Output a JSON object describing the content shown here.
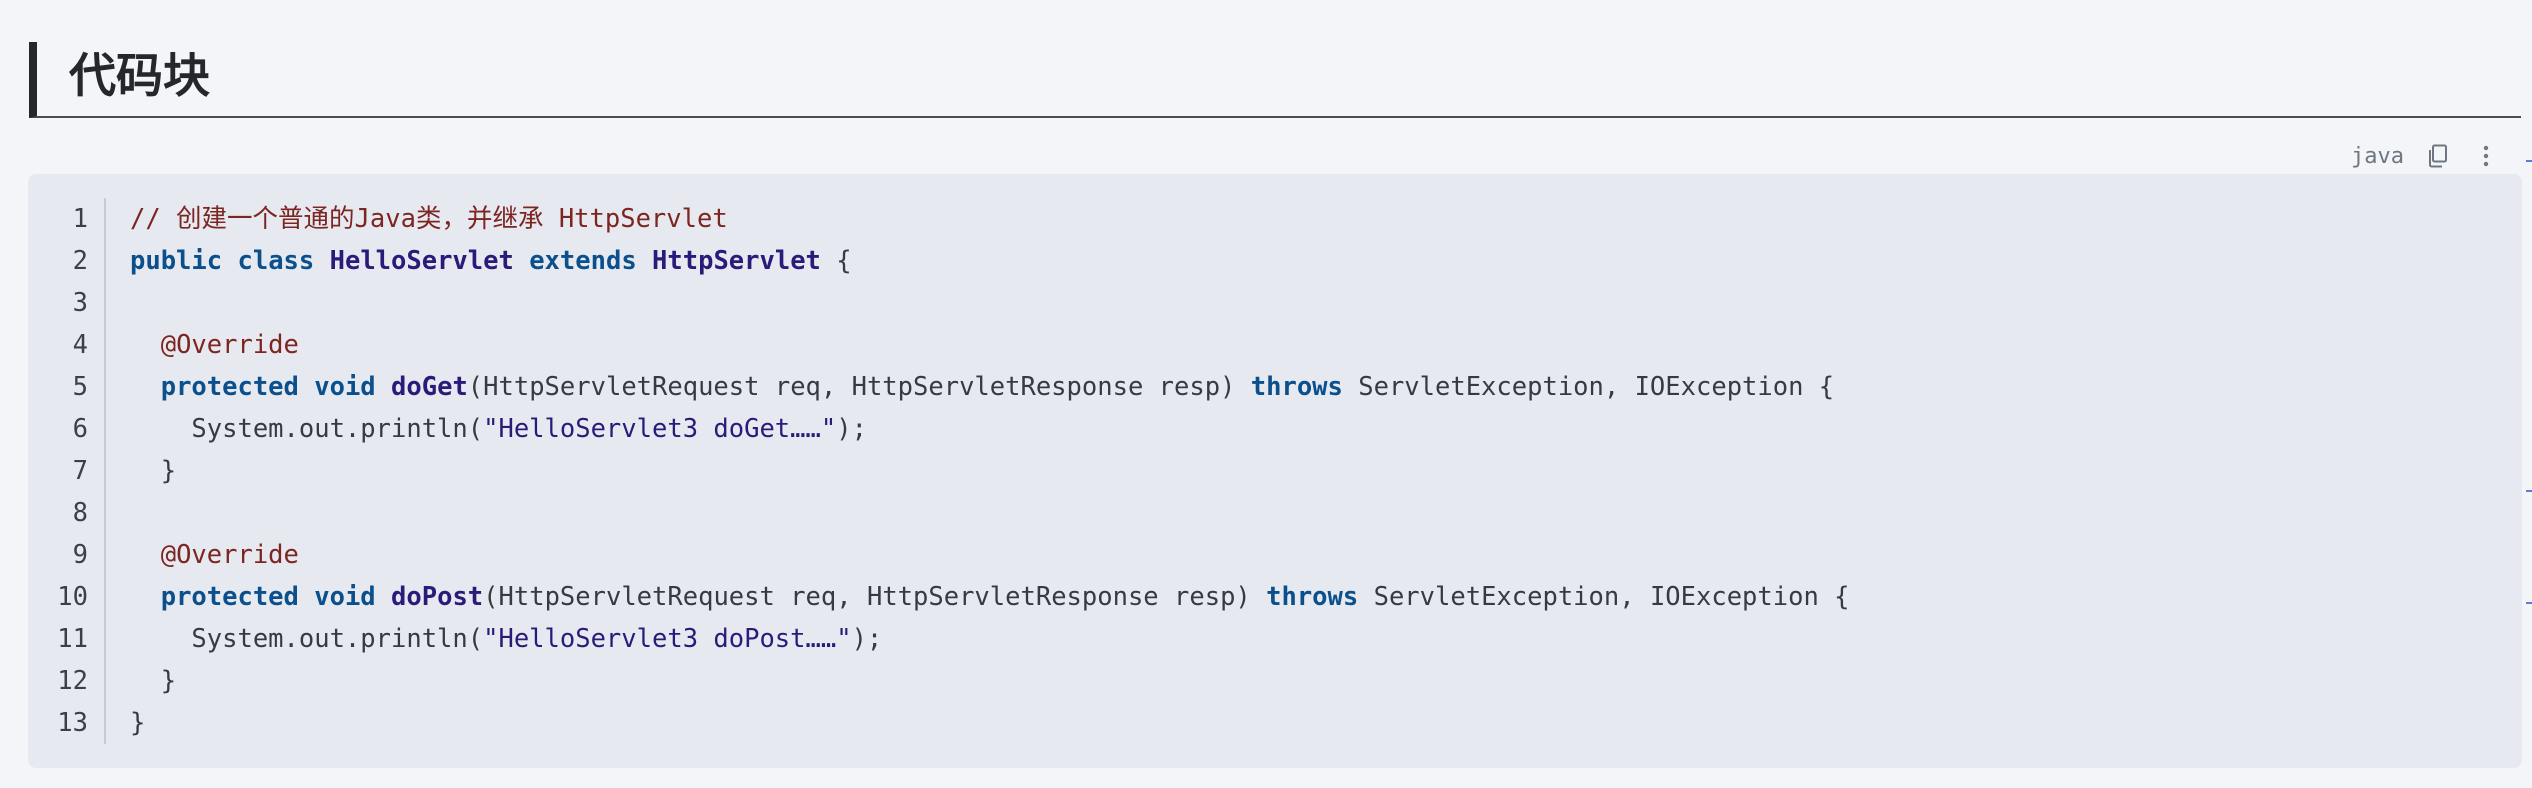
{
  "heading": {
    "title": "代码块"
  },
  "code_block": {
    "language": "java",
    "copy_icon": "copy-icon",
    "more_icon": "more-vertical-icon",
    "lines": [
      {
        "n": "1",
        "tokens": [
          {
            "t": "comment",
            "v": "// 创建一个普通的Java类，并继承 HttpServlet"
          }
        ]
      },
      {
        "n": "2",
        "tokens": [
          {
            "t": "kw",
            "v": "public"
          },
          {
            "t": "plain",
            "v": " "
          },
          {
            "t": "kw",
            "v": "class"
          },
          {
            "t": "plain",
            "v": " "
          },
          {
            "t": "cls",
            "v": "HelloServlet"
          },
          {
            "t": "plain",
            "v": " "
          },
          {
            "t": "kw",
            "v": "extends"
          },
          {
            "t": "plain",
            "v": " "
          },
          {
            "t": "cls",
            "v": "HttpServlet"
          },
          {
            "t": "plain",
            "v": " {"
          }
        ]
      },
      {
        "n": "3",
        "tokens": []
      },
      {
        "n": "4",
        "tokens": [
          {
            "t": "plain",
            "v": "  "
          },
          {
            "t": "ann",
            "v": "@Override"
          }
        ]
      },
      {
        "n": "5",
        "tokens": [
          {
            "t": "plain",
            "v": "  "
          },
          {
            "t": "kw",
            "v": "protected"
          },
          {
            "t": "plain",
            "v": " "
          },
          {
            "t": "kw",
            "v": "void"
          },
          {
            "t": "plain",
            "v": " "
          },
          {
            "t": "fn",
            "v": "doGet"
          },
          {
            "t": "plain",
            "v": "(HttpServletRequest req, HttpServletResponse resp) "
          },
          {
            "t": "kw",
            "v": "throws"
          },
          {
            "t": "plain",
            "v": " ServletException, IOException {"
          }
        ]
      },
      {
        "n": "6",
        "tokens": [
          {
            "t": "plain",
            "v": "    System.out.println("
          },
          {
            "t": "str",
            "v": "\"HelloServlet3 doGet……\""
          },
          {
            "t": "plain",
            "v": ");"
          }
        ]
      },
      {
        "n": "7",
        "tokens": [
          {
            "t": "plain",
            "v": "  }"
          }
        ]
      },
      {
        "n": "8",
        "tokens": []
      },
      {
        "n": "9",
        "tokens": [
          {
            "t": "plain",
            "v": "  "
          },
          {
            "t": "ann",
            "v": "@Override"
          }
        ]
      },
      {
        "n": "10",
        "tokens": [
          {
            "t": "plain",
            "v": "  "
          },
          {
            "t": "kw",
            "v": "protected"
          },
          {
            "t": "plain",
            "v": " "
          },
          {
            "t": "kw",
            "v": "void"
          },
          {
            "t": "plain",
            "v": " "
          },
          {
            "t": "fn",
            "v": "doPost"
          },
          {
            "t": "plain",
            "v": "(HttpServletRequest req, HttpServletResponse resp) "
          },
          {
            "t": "kw",
            "v": "throws"
          },
          {
            "t": "plain",
            "v": " ServletException, IOException {"
          }
        ]
      },
      {
        "n": "11",
        "tokens": [
          {
            "t": "plain",
            "v": "    System.out.println("
          },
          {
            "t": "str",
            "v": "\"HelloServlet3 doPost……\""
          },
          {
            "t": "plain",
            "v": ");"
          }
        ]
      },
      {
        "n": "12",
        "tokens": [
          {
            "t": "plain",
            "v": "  }"
          }
        ]
      },
      {
        "n": "13",
        "tokens": [
          {
            "t": "plain",
            "v": "}"
          }
        ]
      }
    ]
  },
  "colors": {
    "background": "#f3f5f9",
    "code_background": "#e6eaf0",
    "keyword": "#0b4f8c",
    "class_name": "#2a1b7a",
    "comment": "#7d2521"
  }
}
